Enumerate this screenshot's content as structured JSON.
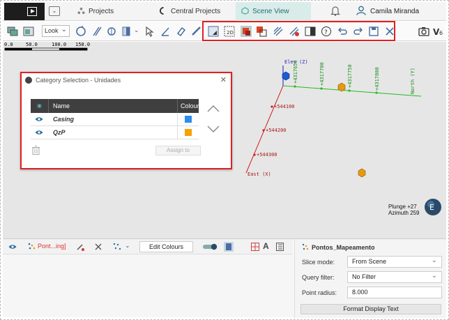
{
  "topbar": {
    "tabs": [
      {
        "label": "Projects"
      },
      {
        "label": "Central Projects (Offli..."
      },
      {
        "label": "Scene View"
      }
    ],
    "user_name": "Camila Miranda"
  },
  "toolbar": {
    "look_label": "Look"
  },
  "scene": {
    "axis_elev": "Elev (Z)",
    "axis_north": "North (Y)",
    "axis_east": "East (X)",
    "north_ticks": [
      "+4317650",
      "+4317700",
      "+4317750",
      "+4317800"
    ],
    "east_ticks": [
      "+544100",
      "+544200",
      "+544300"
    ],
    "plunge": "Plunge +27",
    "azimuth": "Azimuth 259",
    "scale_ticks": [
      "0.0",
      "50.0",
      "100.0",
      "150.0"
    ],
    "compass_letter": "E"
  },
  "dialog": {
    "title": "Category Selection - Unidades",
    "col_name": "Name",
    "col_colour": "Colour",
    "rows": [
      {
        "name": "Casing",
        "color": "#2a8df0"
      },
      {
        "name": "QzP",
        "color": "#f5a100"
      }
    ],
    "assign_label": "Assign to"
  },
  "bottom": {
    "layer_name": "Pont...ing]",
    "edit_colours": "Edit Colours"
  },
  "properties": {
    "title": "Pontos_Mapeamento",
    "slice_mode_label": "Slice mode:",
    "slice_mode_value": "From Scene",
    "query_filter_label": "Query filter:",
    "query_filter_value": "No Filter",
    "point_radius_label": "Point radius:",
    "point_radius_value": "8.000",
    "format_button": "Format Display Text"
  }
}
